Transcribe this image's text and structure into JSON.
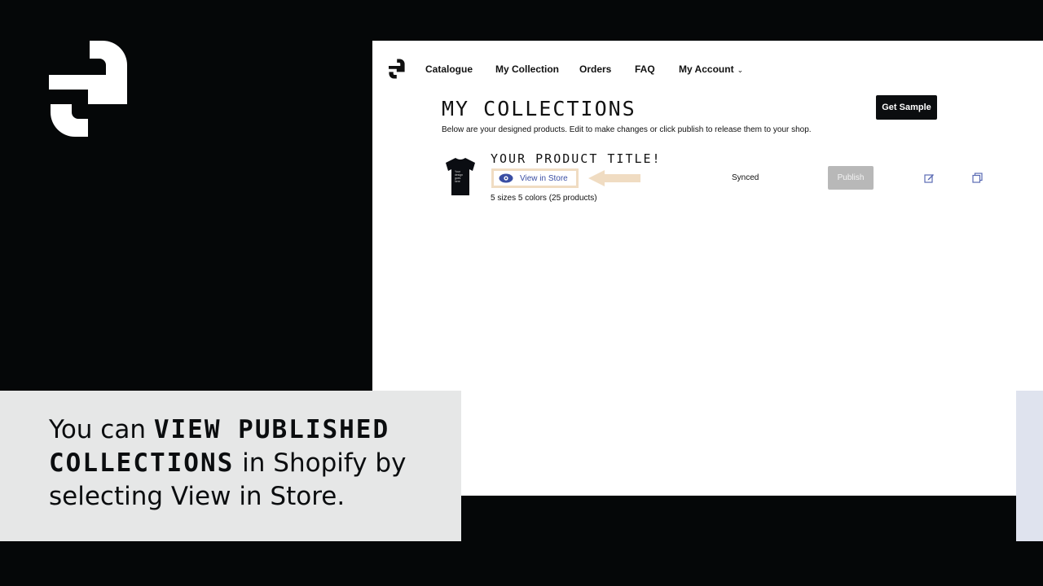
{
  "nav": {
    "items": [
      {
        "label": "Catalogue"
      },
      {
        "label": "My Collection"
      },
      {
        "label": "Orders"
      },
      {
        "label": "FAQ"
      },
      {
        "label": "My Account"
      }
    ]
  },
  "page": {
    "title": "MY COLLECTIONS",
    "subtitle": "Below are your designed products. Edit to make changes or click publish to release them to your shop.",
    "get_sample_label": "Get Sample"
  },
  "product": {
    "title": "YOUR PRODUCT TITLE!",
    "view_in_store_label": "View in Store",
    "variants": "5 sizes 5 colors (25 products)",
    "status": "Synced",
    "publish_label": "Publish",
    "shirt_print": [
      "Your",
      "design",
      "goes",
      "here"
    ]
  },
  "caption": {
    "part1": "You can ",
    "highlight1": "VIEW PUBLISHED",
    "highlight2": "COLLECTIONS",
    "part2": " in Shopify by",
    "part3": "selecting View in Store."
  },
  "colors": {
    "background": "#050708",
    "panel": "#ffffff",
    "caption_bg": "#e6e7e7",
    "button_dark": "#0b0d0f",
    "publish_disabled": "#b8b8b8",
    "highlight_box": "#f0dcc2",
    "link_blue": "#3a4ea3"
  },
  "icons": [
    "brand-logo-icon",
    "eye-icon",
    "arrow-left-icon",
    "edit-icon",
    "copy-icon",
    "chevron-down-icon",
    "tshirt-icon"
  ]
}
